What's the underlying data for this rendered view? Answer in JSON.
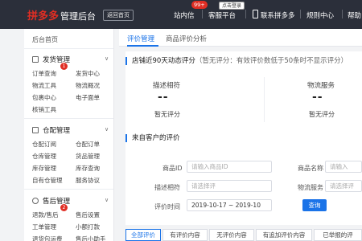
{
  "topbar": {
    "brand": "拼多多",
    "brand_suffix": "管理后台",
    "home_label": "返回首页",
    "messages_label": "站内信",
    "messages_badge": "99+",
    "service_label": "客服平台",
    "service_tip": "点击登录",
    "contact_label": "联系拼多多",
    "rules_label": "规则中心",
    "help_label": "帮助"
  },
  "sidebar": {
    "home": "后台首页",
    "groups": [
      {
        "title": "发货管理",
        "badge": "1",
        "links": [
          "订单查询",
          "发货中心",
          "物流工具",
          "物流概况",
          "包裹中心",
          "电子面单",
          "核销工具"
        ]
      },
      {
        "title": "仓配管理",
        "links": [
          "仓配订阅",
          "仓配订单",
          "仓库管理",
          "货品管理",
          "库存管理",
          "库存查询",
          "自有仓管理",
          "服务协议"
        ]
      },
      {
        "title": "售后管理",
        "badge": "2",
        "links": [
          "退款/售后",
          "售后设置",
          "工单管理",
          "小额打款",
          "退货包运费",
          "售后小助手"
        ]
      }
    ]
  },
  "tabs": [
    "评价管理",
    "商品评价分析"
  ],
  "rating_panel": {
    "title": "店铺近90天动态评分",
    "note": "（暂无评分：有效评价数低于50条时不显示评分）",
    "metrics": [
      {
        "label": "描述相符",
        "value": "--",
        "status": "暂无评分"
      },
      {
        "label": "物流服务",
        "value": "--",
        "status": "暂无评分"
      }
    ]
  },
  "reviews_panel": {
    "title": "来自客户的评价",
    "fields": {
      "goods_id_label": "商品ID",
      "goods_id_placeholder": "请输入商品ID",
      "goods_name_label": "商品名称",
      "goods_name_placeholder": "请输入",
      "desc_label": "描述相符",
      "desc_placeholder": "请选择评",
      "logistics_label": "物流服务",
      "logistics_placeholder": "请选择评",
      "time_label": "评价时间",
      "time_value": "2019-10-17 ~ 2019-10",
      "search_label": "查询"
    }
  },
  "filter_tabs": [
    "全部评价",
    "有评价内容",
    "无评价内容",
    "有追加评价内容",
    "已举报的评"
  ]
}
